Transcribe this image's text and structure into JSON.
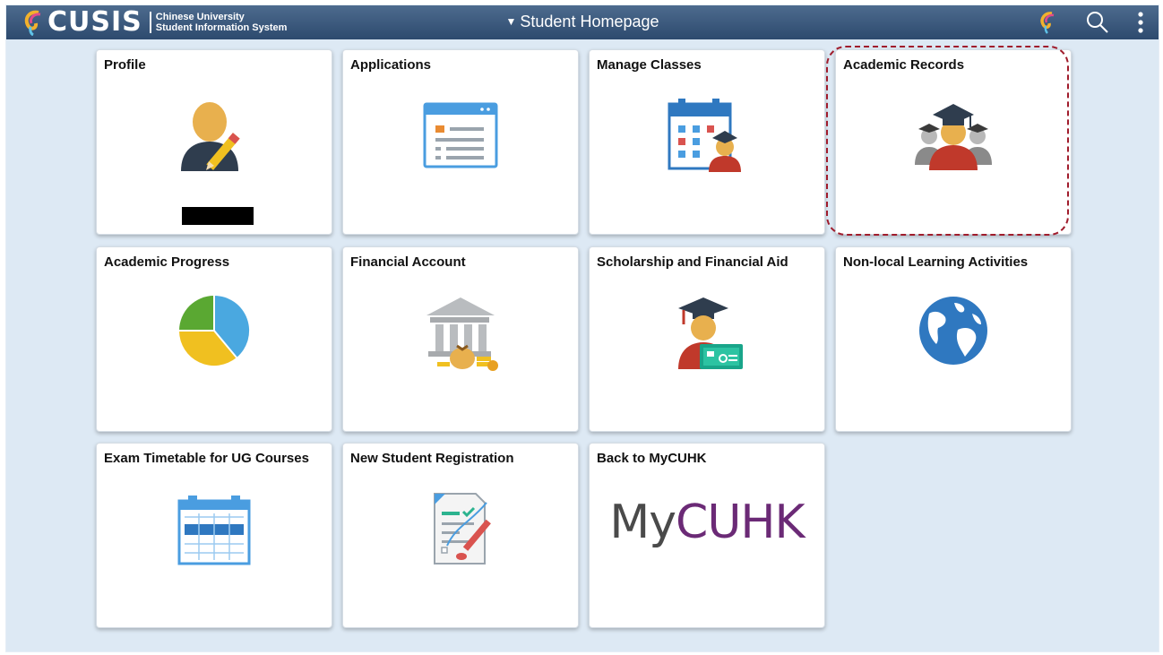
{
  "header": {
    "logo_text": "CUSIS",
    "logo_sub_line1": "Chinese University",
    "logo_sub_line2": "Student Information System",
    "title": "Student Homepage"
  },
  "tiles": [
    {
      "label": "Profile",
      "icon": "profile-edit-icon"
    },
    {
      "label": "Applications",
      "icon": "application-form-icon"
    },
    {
      "label": "Manage Classes",
      "icon": "class-calendar-icon"
    },
    {
      "label": "Academic Records",
      "icon": "graduates-icon"
    },
    {
      "label": "Academic Progress",
      "icon": "pie-chart-icon"
    },
    {
      "label": "Financial Account",
      "icon": "bank-icon"
    },
    {
      "label": "Scholarship and Financial Aid",
      "icon": "graduate-card-icon"
    },
    {
      "label": "Non-local Learning Activities",
      "icon": "globe-icon"
    },
    {
      "label": "Exam Timetable for UG Courses",
      "icon": "timetable-icon"
    },
    {
      "label": "New Student Registration",
      "icon": "registration-form-icon"
    },
    {
      "label": "Back to MyCUHK",
      "icon": "mycuhk-logo"
    }
  ],
  "mycuhk": {
    "my": "My",
    "cuhk": "CUHK"
  },
  "colors": {
    "header": "#3b5a80",
    "background": "#dde9f4",
    "focus": "#a01c2c",
    "mycuhk": "#6b2a76"
  }
}
